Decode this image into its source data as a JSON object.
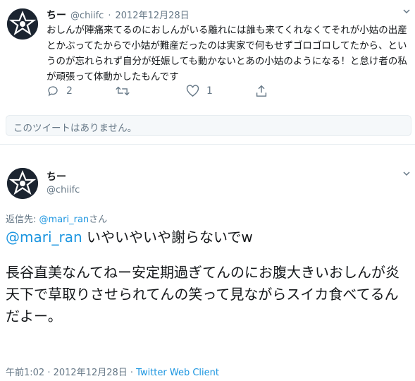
{
  "tweet1": {
    "name": "ちー",
    "handle": "@chiifc",
    "sep": "·",
    "date": "2012年12月28日",
    "text": "おしんが陣痛来てるのにおしんがいる離れには誰も来てくれなくてそれが小姑の出産とかぶってたからで小姑が難産だったのは実家で何もせずゴロゴロしてたから、というのが忘れられず自分が妊娠しても動かないとあの小姑のようになる！と怠け者の私が頑張って体動かしたもんです",
    "reply_count": "2",
    "like_count": "1"
  },
  "unavailable": {
    "text": "このツイートはありません。"
  },
  "tweet2": {
    "name": "ちー",
    "handle": "@chiifc",
    "reply_prefix": "返信先: ",
    "reply_handle": "@mari_ran",
    "reply_suffix": "さん",
    "mention": "@mari_ran",
    "line1_rest": " いやいやいや謝らないでw",
    "paragraph": "長谷直美なんてねー安定期過ぎてんのにお腹大きいおしんが炎天下で草取りさせられてんの笑って見ながらスイカ食べてるんだよー。",
    "time": "午前1:02 · 2012年12月28日 · ",
    "client": "Twitter Web Client"
  },
  "icons": {
    "avatar": "star-avatar-icon",
    "chevron": "chevron-down-icon",
    "reply": "reply-icon",
    "retweet": "retweet-icon",
    "like": "heart-icon",
    "share": "share-icon"
  },
  "colors": {
    "link": "#1b95e0",
    "secondary": "#657786",
    "border": "#e6ecf0"
  }
}
